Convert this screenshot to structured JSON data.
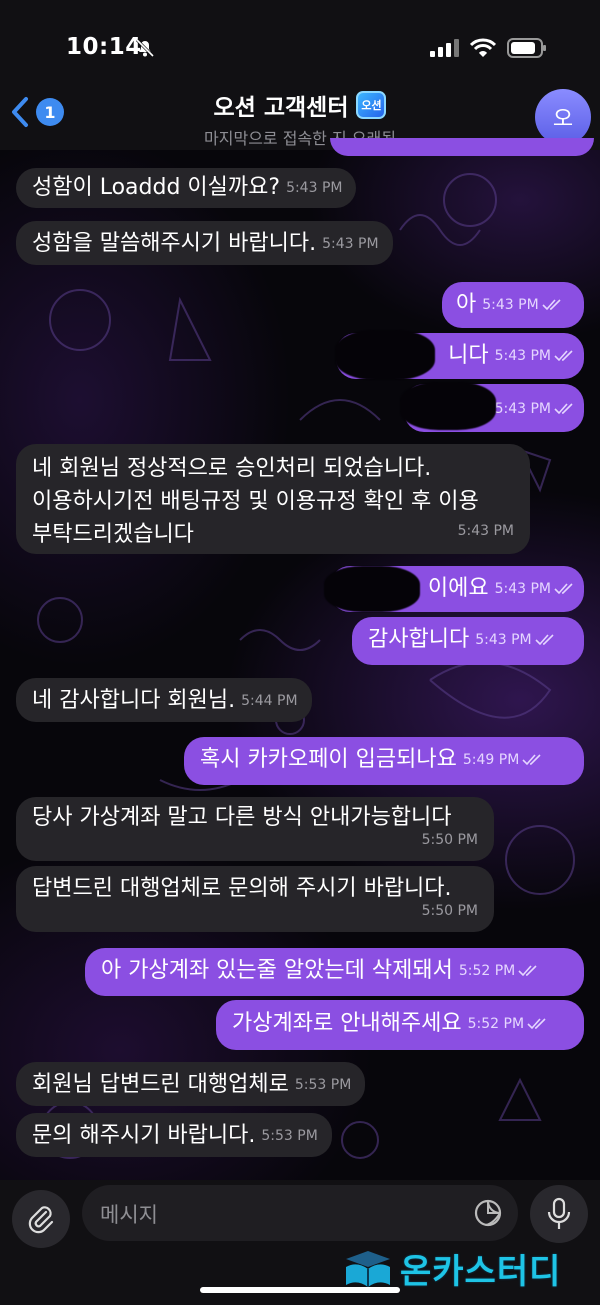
{
  "status": {
    "time": "10:14"
  },
  "header": {
    "back_count": "1",
    "title": "오션 고객센터",
    "logo_text": "오션",
    "subtitle": "마지막으로 접속한 지 오래됨",
    "avatar_initial": "오"
  },
  "messages": [
    {
      "dir": "in",
      "text": "성함이 Loaddd 이실까요?",
      "time": "5:43 PM"
    },
    {
      "dir": "in",
      "text": "성함을 말씀해주시기 바랍니다.",
      "time": "5:43 PM"
    },
    {
      "dir": "out",
      "text": "아",
      "time": "5:43 PM"
    },
    {
      "dir": "out",
      "text": "니다",
      "time": "5:43 PM",
      "redacted": true
    },
    {
      "dir": "out",
      "text": "",
      "time": "5:43 PM",
      "redacted": true
    },
    {
      "dir": "in",
      "lines": [
        "네 회원님 정상적으로 승인처리 되었습니다.",
        "이용하시기전 배팅규정 및 이용규정 확인 후 이용",
        "부탁드리겠습니다"
      ],
      "time": "5:43 PM"
    },
    {
      "dir": "out",
      "text": "이에요",
      "time": "5:43 PM",
      "redacted": true
    },
    {
      "dir": "out",
      "text": "감사합니다",
      "time": "5:43 PM"
    },
    {
      "dir": "in",
      "text": "네 감사합니다 회원님.",
      "time": "5:44 PM"
    },
    {
      "dir": "out",
      "text": "혹시 카카오페이 입금되나요",
      "time": "5:49 PM"
    },
    {
      "dir": "in",
      "text": "당사 가상계좌 말고 다른 방식 안내가능합니다",
      "time": "5:50 PM"
    },
    {
      "dir": "in",
      "text": "답변드린 대행업체로 문의해 주시기 바랍니다.",
      "time": "5:50 PM"
    },
    {
      "dir": "out",
      "text": "아 가상계좌 있는줄 알았는데 삭제돼서",
      "time": "5:52 PM"
    },
    {
      "dir": "out",
      "text": "가상계좌로 안내해주세요",
      "time": "5:52 PM"
    },
    {
      "dir": "in",
      "text": "회원님 답변드린 대행업체로",
      "time": "5:53 PM"
    },
    {
      "dir": "in",
      "text": "문의 해주시기 바랍니다.",
      "time": "5:53 PM"
    }
  ],
  "input": {
    "placeholder": "메시지"
  },
  "watermark": {
    "text": "온카스터디"
  },
  "colors": {
    "outgoing": "#8b4fe2",
    "incoming": "#262529",
    "accent": "#3e8bf0"
  },
  "icons": [
    "bell-slash-icon",
    "signal-icon",
    "wifi-icon",
    "battery-icon",
    "back-chevron-icon",
    "paperclip-icon",
    "sticker-icon",
    "mic-icon",
    "double-check-icon"
  ]
}
